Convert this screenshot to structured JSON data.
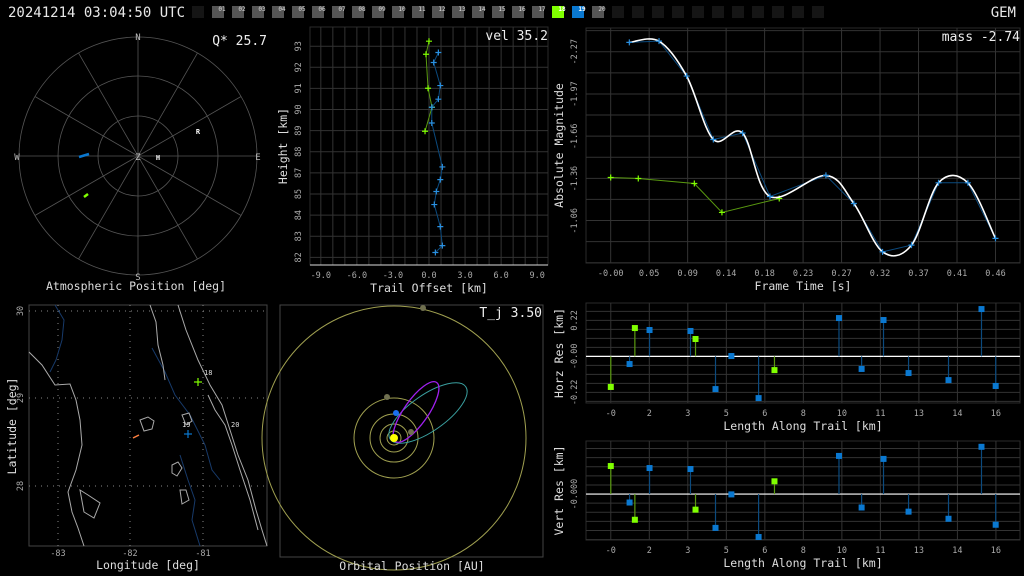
{
  "header": {
    "timestamp": "20241214 03:04:50 UTC",
    "shower": "GEM",
    "stations": [
      {
        "label": "",
        "state": "off"
      },
      {
        "label": "01",
        "state": "on"
      },
      {
        "label": "02",
        "state": "on"
      },
      {
        "label": "03",
        "state": "on"
      },
      {
        "label": "04",
        "state": "on"
      },
      {
        "label": "05",
        "state": "on"
      },
      {
        "label": "06",
        "state": "on"
      },
      {
        "label": "07",
        "state": "on"
      },
      {
        "label": "08",
        "state": "on"
      },
      {
        "label": "09",
        "state": "on"
      },
      {
        "label": "10",
        "state": "on"
      },
      {
        "label": "11",
        "state": "on"
      },
      {
        "label": "12",
        "state": "on"
      },
      {
        "label": "13",
        "state": "on"
      },
      {
        "label": "14",
        "state": "on"
      },
      {
        "label": "15",
        "state": "on"
      },
      {
        "label": "16",
        "state": "on"
      },
      {
        "label": "17",
        "state": "on"
      },
      {
        "label": "18",
        "state": "green"
      },
      {
        "label": "19",
        "state": "blue"
      },
      {
        "label": "20",
        "state": "on"
      },
      {
        "label": "",
        "state": "off"
      },
      {
        "label": "",
        "state": "off"
      },
      {
        "label": "",
        "state": "off"
      },
      {
        "label": "",
        "state": "off"
      },
      {
        "label": "",
        "state": "off"
      },
      {
        "label": "",
        "state": "off"
      },
      {
        "label": "",
        "state": "off"
      },
      {
        "label": "",
        "state": "off"
      },
      {
        "label": "",
        "state": "off"
      },
      {
        "label": "",
        "state": "off"
      },
      {
        "label": "",
        "state": "off"
      }
    ]
  },
  "colors": {
    "green": "#80ff00",
    "blue": "#0a78d0",
    "green_dark": "#5a9a10",
    "blue_dark": "#0b4a7e",
    "grid": "#333333",
    "station_on": "#555555",
    "station_off": "#151515"
  },
  "polar": {
    "title": "Atmospheric Position [deg]",
    "metric": "Q* 25.7",
    "compass": {
      "n": "N",
      "s": "S",
      "e": "E",
      "w": "W",
      "z": "Z"
    },
    "markers": {
      "radiant": "R",
      "meteor": "H"
    }
  },
  "map": {
    "xlabel": "Longitude [deg]",
    "ylabel": "Latitude [deg]",
    "xticks": [
      "-83",
      "-82",
      "-81"
    ],
    "yticks": [
      "30",
      "29",
      "28"
    ],
    "station_labels": {
      "s18": "18",
      "s19": "19",
      "s20": "20"
    }
  },
  "orbit": {
    "title": "Orbital Position [AU]",
    "metric": "T_j 3.50"
  },
  "chart_data": [
    {
      "id": "trail",
      "type": "line",
      "title": "",
      "metric": "vel 35.2",
      "xlabel": "Trail Offset [km]",
      "ylabel": "Height [km]",
      "xlim": [
        -9.9,
        9.9
      ],
      "ylim": [
        81.6,
        94.0
      ],
      "grid_step": [
        1,
        1.1
      ],
      "grid_origin": [
        0,
        82
      ],
      "xticks": {
        "values": [
          -9,
          -6,
          -3,
          0,
          3,
          6,
          9
        ],
        "labels": [
          "-9.0",
          "-6.0",
          "-3.0",
          "0.0",
          "3.0",
          "6.0",
          "9.0"
        ]
      },
      "yticks": {
        "values": [
          93,
          91.9,
          90.8,
          89.7,
          88.6,
          87.5,
          86.4,
          85.3,
          84.2,
          83.1,
          82
        ],
        "labels": [
          "93",
          "92",
          "91",
          "90",
          "89",
          "88",
          "87",
          "85",
          "84",
          "83",
          "82"
        ]
      },
      "series": [
        {
          "name": "station 18",
          "color": "green",
          "points": [
            [
              0.0,
              93.26
            ],
            [
              -0.25,
              92.58
            ],
            [
              -0.08,
              90.81
            ],
            [
              0.25,
              89.82
            ],
            [
              -0.33,
              88.57
            ]
          ]
        },
        {
          "name": "station 19",
          "color": "blue",
          "points": [
            [
              0.78,
              92.67
            ],
            [
              0.39,
              92.15
            ],
            [
              0.94,
              90.95
            ],
            [
              0.78,
              90.24
            ],
            [
              0.23,
              89.82
            ],
            [
              0.23,
              89.0
            ],
            [
              1.11,
              86.71
            ],
            [
              0.94,
              86.05
            ],
            [
              0.61,
              85.43
            ],
            [
              0.44,
              84.75
            ],
            [
              0.94,
              83.6
            ],
            [
              1.11,
              82.61
            ],
            [
              0.53,
              82.25
            ]
          ]
        }
      ]
    },
    {
      "id": "magnitude",
      "type": "line",
      "metric": "mass -2.74",
      "xlabel": "Frame Time [s]",
      "ylabel": "Absolute Magnitude",
      "xlim": [
        -0.0295,
        0.4893
      ],
      "ylim": [
        -0.758,
        -2.44
      ],
      "grid_step": [
        0.046,
        0.151
      ],
      "grid_origin": [
        0,
        -2.27
      ],
      "xticks": {
        "values": [
          0,
          0.046,
          0.092,
          0.138,
          0.184,
          0.23,
          0.276,
          0.322,
          0.368,
          0.414,
          0.46
        ],
        "labels": [
          "-0.00",
          "0.05",
          "0.09",
          "0.14",
          "0.18",
          "0.23",
          "0.27",
          "0.32",
          "0.37",
          "0.41",
          "0.46"
        ]
      },
      "yticks": {
        "values": [
          -2.27,
          -1.967,
          -1.665,
          -1.362,
          -1.06
        ],
        "labels": [
          "-2.27",
          "-1.97",
          "-1.66",
          "-1.36",
          "-1.06"
        ]
      },
      "series": [
        {
          "name": "station 18",
          "color": "green",
          "points": [
            [
              0,
              -1.37
            ],
            [
              0.033,
              -1.363
            ],
            [
              0.1,
              -1.327
            ],
            [
              0.133,
              -1.12
            ],
            [
              0.2015,
              -1.22
            ]
          ]
        },
        {
          "name": "station 19",
          "color": "blue",
          "smooth_fit": true,
          "points": [
            [
              0.0223,
              -2.337
            ],
            [
              0.0578,
              -2.346
            ],
            [
              0.0908,
              -2.096
            ],
            [
              0.1227,
              -1.642
            ],
            [
              0.1577,
              -1.688
            ],
            [
              0.1904,
              -1.234
            ],
            [
              0.2573,
              -1.385
            ],
            [
              0.2907,
              -1.184
            ],
            [
              0.325,
              -0.838
            ],
            [
              0.3596,
              -0.886
            ],
            [
              0.3919,
              -1.332
            ],
            [
              0.427,
              -1.332
            ],
            [
              0.46,
              -0.934
            ]
          ]
        }
      ]
    },
    {
      "id": "horz_res",
      "type": "scatter",
      "style": "stem",
      "xlabel": "Length Along Trail [km]",
      "ylabel": "Horz Res [km]",
      "xlim": [
        -1.03,
        17.0
      ],
      "ylim": [
        -0.285,
        0.326
      ],
      "grid_step": [
        1.6,
        0.055
      ],
      "grid_origin": [
        0,
        0
      ],
      "xticks": {
        "values": [
          0,
          1.6,
          3.2,
          4.8,
          6.4,
          8,
          9.6,
          11.2,
          12.8,
          14.4,
          16
        ],
        "labels": [
          "-0",
          "2",
          "3",
          "5",
          "6",
          "8",
          "10",
          "11",
          "13",
          "14",
          "16"
        ]
      },
      "yticks": {
        "values": [
          0.22,
          0,
          -0.22
        ],
        "labels": [
          "0.22",
          "-0.00",
          "-0.22"
        ]
      },
      "series": [
        {
          "name": "station 18",
          "color": "green",
          "points": [
            [
              0,
              -0.187
            ],
            [
              1.0,
              0.173
            ],
            [
              3.52,
              0.106
            ],
            [
              6.8,
              -0.084
            ]
          ]
        },
        {
          "name": "station 19",
          "color": "blue",
          "points": [
            [
              0.78,
              -0.047
            ],
            [
              1.61,
              0.161
            ],
            [
              3.31,
              0.155
            ],
            [
              4.35,
              -0.2
            ],
            [
              5.01,
              0.002
            ],
            [
              6.14,
              -0.255
            ],
            [
              9.48,
              0.234
            ],
            [
              10.42,
              -0.077
            ],
            [
              11.33,
              0.222
            ],
            [
              12.37,
              -0.102
            ],
            [
              14.03,
              -0.145
            ],
            [
              15.4,
              0.289
            ],
            [
              15.99,
              -0.181
            ]
          ]
        }
      ]
    },
    {
      "id": "vert_res",
      "type": "scatter",
      "style": "stem",
      "xlabel": "Length Along Trail [km]",
      "ylabel": "Vert Res [km]",
      "xlim": [
        -1.03,
        17.0
      ],
      "ylim": [
        -0.277,
        0.32
      ],
      "grid_step": [
        1.6,
        0.055
      ],
      "grid_origin": [
        0,
        0
      ],
      "xticks": {
        "values": [
          0,
          1.6,
          3.2,
          4.8,
          6.4,
          8,
          9.6,
          11.2,
          12.8,
          14.4,
          16
        ],
        "labels": [
          "-0",
          "2",
          "3",
          "5",
          "6",
          "8",
          "10",
          "11",
          "13",
          "14",
          "16"
        ]
      },
      "yticks": {
        "values": [
          0
        ],
        "labels": [
          "-0.000"
        ]
      },
      "series": [
        {
          "name": "station 18",
          "color": "green",
          "points": [
            [
              0,
              0.169
            ],
            [
              1.0,
              -0.155
            ],
            [
              3.52,
              -0.094
            ],
            [
              6.8,
              0.077
            ]
          ]
        },
        {
          "name": "station 19",
          "color": "blue",
          "points": [
            [
              0.78,
              -0.051
            ],
            [
              1.61,
              0.157
            ],
            [
              3.31,
              0.151
            ],
            [
              4.35,
              -0.204
            ],
            [
              5.01,
              -0.002
            ],
            [
              6.14,
              -0.259
            ],
            [
              9.48,
              0.23
            ],
            [
              10.42,
              -0.081
            ],
            [
              11.33,
              0.212
            ],
            [
              12.37,
              -0.106
            ],
            [
              14.03,
              -0.149
            ],
            [
              15.4,
              0.285
            ],
            [
              15.99,
              -0.185
            ]
          ]
        }
      ]
    }
  ]
}
